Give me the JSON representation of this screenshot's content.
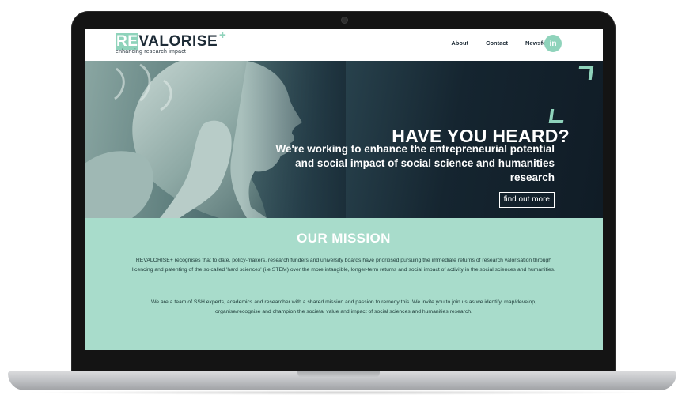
{
  "site": {
    "logo": {
      "re": "RE",
      "valorise": "VALORISE",
      "plus": "+",
      "tagline": "enhancing research impact"
    },
    "nav": {
      "items": [
        {
          "label": "About"
        },
        {
          "label": "Contact"
        },
        {
          "label": "Newsfeed"
        }
      ],
      "social": {
        "label": "in",
        "icon": "linkedin-icon"
      }
    },
    "hero": {
      "heading": "HAVE YOU HEARD?",
      "subheading": "We're working to enhance the entrepreneurial potential and social impact of social science and humanities research",
      "cta_label": "find out more"
    },
    "mission": {
      "title": "OUR MISSION",
      "paragraph1": "REVALORISE+ recognises that to date, policy-makers, research funders and university boards have prioritised pursuing the immediate returns of research valorisation through licencing and patenting of the so called 'hard sciences' (i.e STEM) over the more intangible, longer-term returns and social impact of activity in the social sciences and humanities.",
      "paragraph2": "We are a team of SSH experts, academics and researcher with a shared mission and passion to remedy this.  We invite you to join us as we identify, map/develop, organise/recognise and champion the societal value and impact of social sciences and humanities research."
    }
  },
  "colors": {
    "accent": "#8fd3bb",
    "mission_bg": "#a8dccb",
    "dark_text": "#1d2b36",
    "hero_dark": "#101c26"
  }
}
